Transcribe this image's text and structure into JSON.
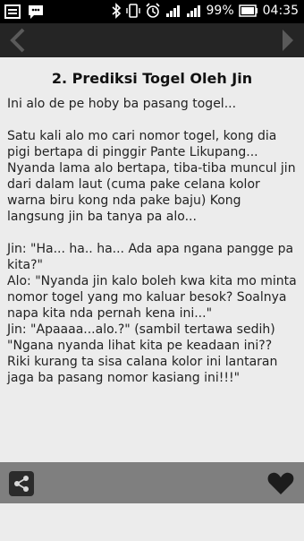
{
  "status_bar": {
    "battery_percent": "99%",
    "time": "04:35",
    "icons": [
      "notification-square-icon",
      "bbm-chat-icon",
      "bluetooth-icon",
      "vibrate-icon",
      "alarm-icon",
      "signal-icon",
      "signal-icon",
      "battery-icon"
    ]
  },
  "toolbar": {
    "prev_icon": "chevron-left-icon",
    "next_icon": "chevron-right-icon"
  },
  "article": {
    "title": "2. Prediksi Togel Oleh Jin",
    "body": "Ini alo de pe hoby ba pasang togel...\n\nSatu kali alo mo cari nomor togel, kong dia pigi bertapa di pinggir Pante Likupang... Nyanda lama alo bertapa, tiba-tiba muncul jin dari dalam laut (cuma pake celana kolor warna biru kong nda pake baju) Kong langsung jin ba tanya pa alo...\n\nJin: \"Ha... ha.. ha... Ada apa ngana pangge pa kita?\"\nAlo: \"Nyanda jin kalo boleh kwa kita mo minta nomor togel yang mo kaluar besok? Soalnya napa kita nda pernah kena ini...\"\nJin: \"Apaaaa...alo.?\" (sambil tertawa sedih)\n\"Ngana nyanda lihat kita pe keadaan ini?? Riki kurang ta sisa calana kolor ini lantaran jaga ba pasang nomor kasiang ini!!!\""
  },
  "bottom_bar": {
    "share_icon": "share-icon",
    "favorite_icon": "heart-icon"
  },
  "colors": {
    "status_bar": "#000000",
    "toolbar": "#252525",
    "content_bg": "#ececec",
    "bottom_bar": "#7f7f7f",
    "nav_arrow": "#5a5a5a"
  }
}
